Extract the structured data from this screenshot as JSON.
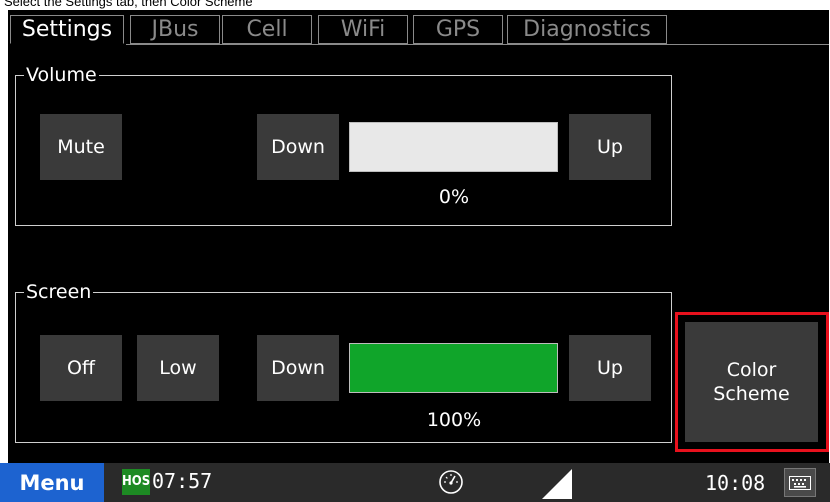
{
  "caption": "Select the Settings tab, then Color Scheme",
  "tabs": [
    {
      "label": "Settings",
      "active": true
    },
    {
      "label": "JBus",
      "active": false
    },
    {
      "label": "Cell",
      "active": false
    },
    {
      "label": "WiFi",
      "active": false
    },
    {
      "label": "GPS",
      "active": false
    },
    {
      "label": "Diagnostics",
      "active": false
    }
  ],
  "volume": {
    "legend": "Volume",
    "mute_label": "Mute",
    "down_label": "Down",
    "up_label": "Up",
    "level_percent": 0,
    "level_text": "0%"
  },
  "screen": {
    "legend": "Screen",
    "off_label": "Off",
    "low_label": "Low",
    "down_label": "Down",
    "up_label": "Up",
    "level_percent": 100,
    "level_text": "100%"
  },
  "color_scheme": {
    "line1": "Color",
    "line2": "Scheme"
  },
  "taskbar": {
    "menu_label": "Menu",
    "hos_badge": "HOS",
    "hos_time": "07:57",
    "clock": "10:08",
    "icons": [
      "gauge-icon",
      "signal-icon",
      "keyboard-icon"
    ]
  },
  "colors": {
    "accent_blue": "#1d63d0",
    "hos_green": "#1d8a23",
    "level_green": "#10a52a",
    "highlight_red": "#e8111d"
  }
}
